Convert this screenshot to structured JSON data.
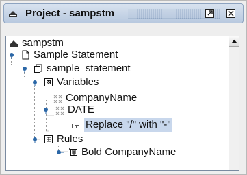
{
  "window": {
    "title": "Project - sampstm",
    "undock_icon": "undock-icon",
    "close_icon": "close-icon"
  },
  "tree": {
    "root": {
      "label": "sampstm",
      "icon": "project-icon"
    },
    "statement": {
      "label": "Sample Statement",
      "icon": "document-icon",
      "expanded": true
    },
    "statement_file": {
      "label": "sample_statement",
      "icon": "copy-icon",
      "expanded": true
    },
    "variables": {
      "label": "Variables",
      "icon": "variables-icon",
      "expanded": true
    },
    "company_name": {
      "label": "CompanyName",
      "icon": "variable-icon"
    },
    "date": {
      "label": "DATE",
      "icon": "variable-icon",
      "expanded": true
    },
    "replace": {
      "label": "Replace \"/\" with \"-\"",
      "icon": "replace-icon",
      "selected": true
    },
    "rules": {
      "label": "Rules",
      "icon": "rules-icon",
      "expanded": true
    },
    "bold_company": {
      "label": "Bold CompanyName",
      "icon": "rule-icon"
    }
  },
  "colors": {
    "title_gradient_top": "#d8e2ef",
    "title_gradient_bottom": "#b8c9df",
    "selection": "#c8d7ec",
    "toggle_handle": "#2b67a7",
    "tree_lines": "#9a9a9a"
  }
}
